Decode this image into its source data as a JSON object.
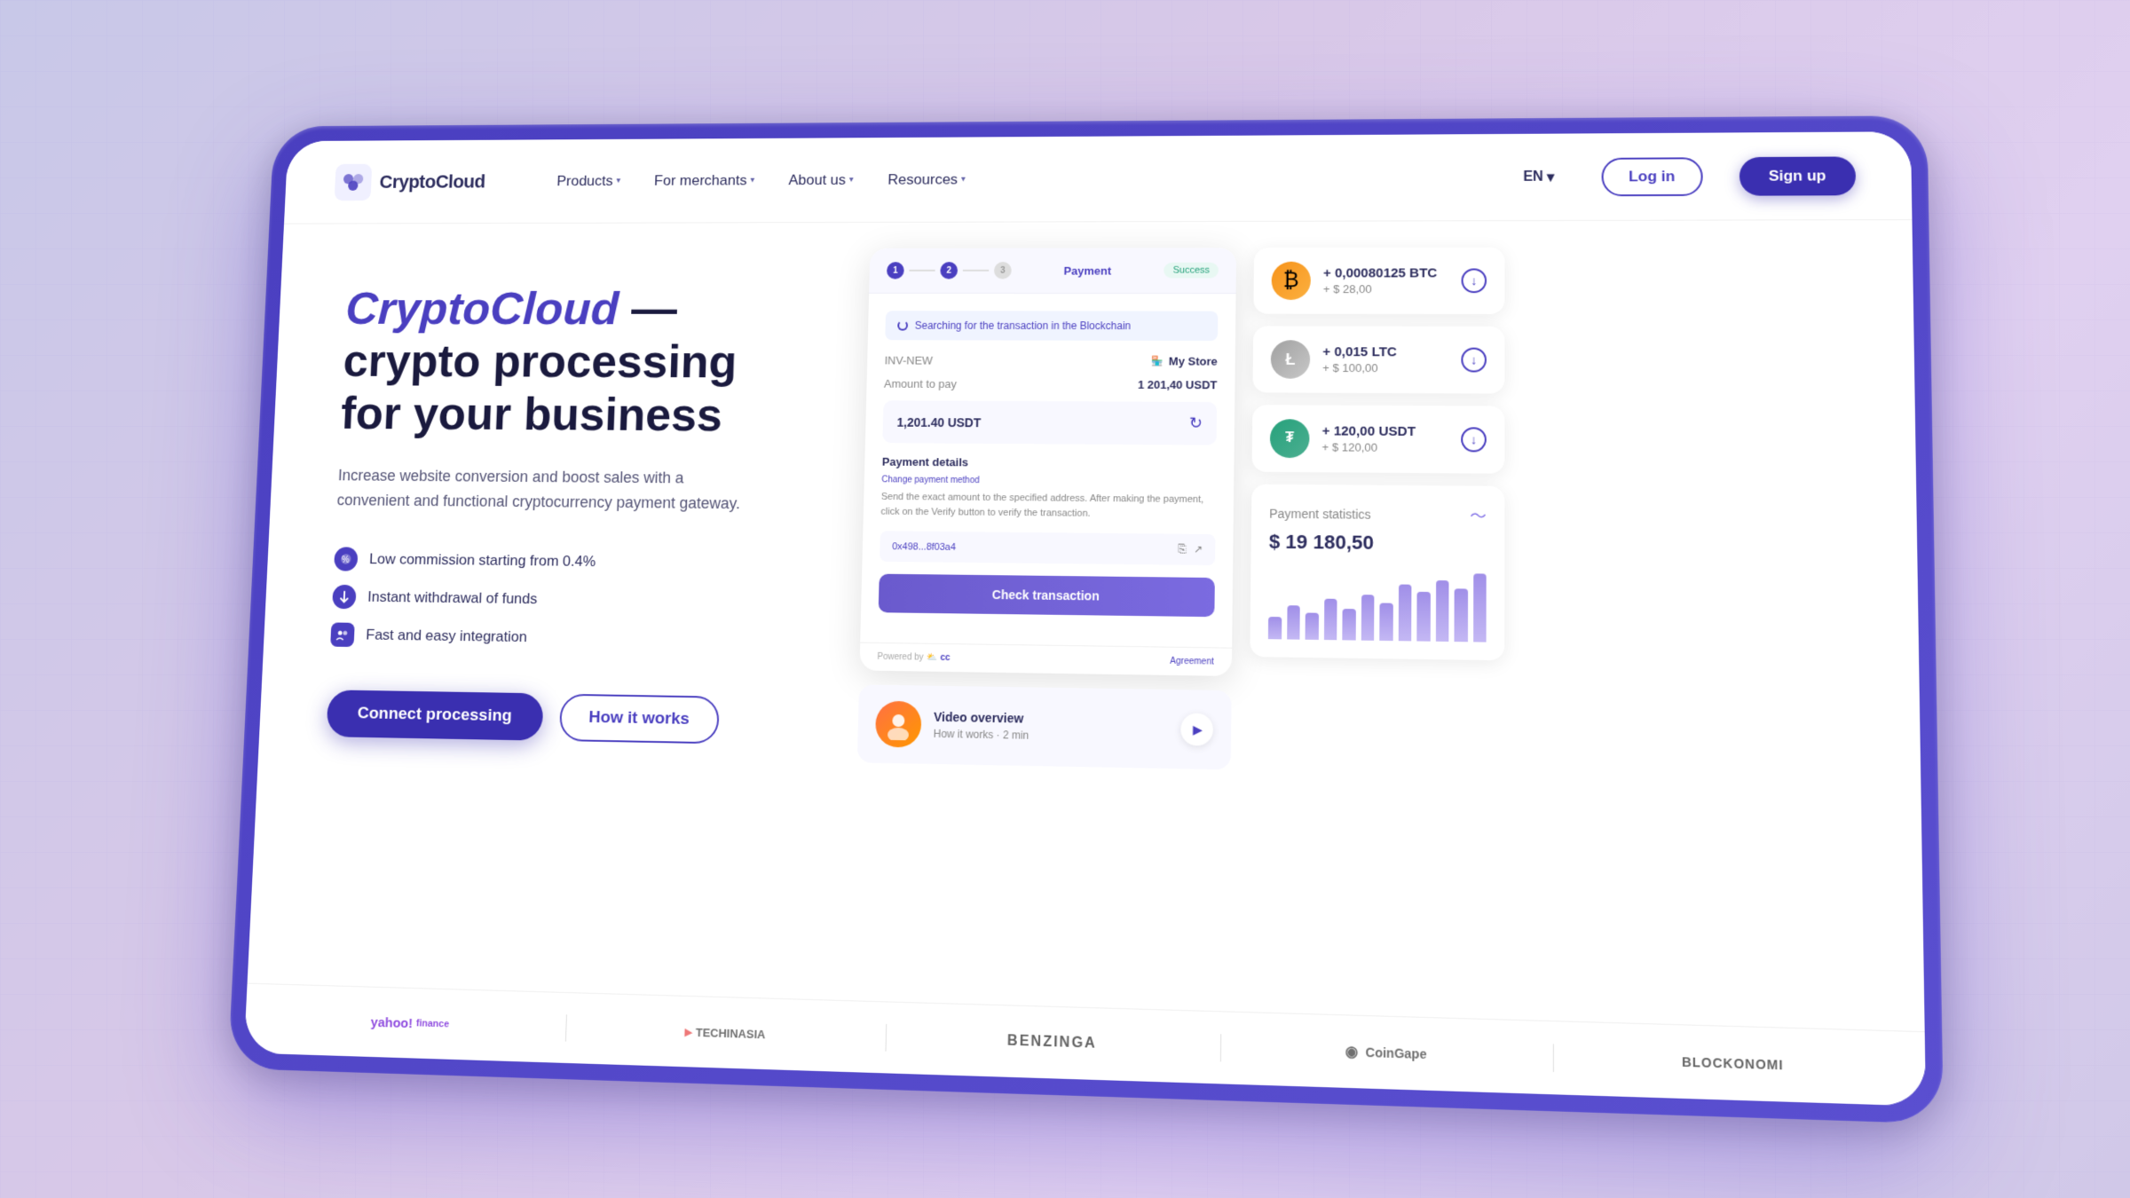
{
  "background": {
    "color_from": "#c8c8e8",
    "color_to": "#d0c8e8"
  },
  "navbar": {
    "logo_text": "CryptoCloud",
    "nav_items": [
      {
        "label": "Products",
        "has_dropdown": true
      },
      {
        "label": "For merchants",
        "has_dropdown": true
      },
      {
        "label": "About us",
        "has_dropdown": true
      },
      {
        "label": "Resources",
        "has_dropdown": true
      }
    ],
    "lang": "EN",
    "login_label": "Log in",
    "signup_label": "Sign up"
  },
  "hero": {
    "title_plain": " — crypto processing for your business",
    "title_highlight": "CryptoCloud",
    "subtitle": "Increase website conversion and boost sales with a convenient and functional cryptocurrency payment gateway.",
    "features": [
      {
        "text": "Low commission starting from 0.4%"
      },
      {
        "text": "Instant withdrawal of funds"
      },
      {
        "text": "Fast and easy integration"
      }
    ],
    "btn_connect": "Connect processing",
    "btn_howworks": "How it works"
  },
  "payment_widget": {
    "searching_text": "Searching for the transaction in the Blockchain",
    "store_label": "My Store",
    "invoice_label": "INV-NEW",
    "amount_label": "Amount to pay",
    "amount_value": "1 201,40 USDT",
    "payment_details_title": "Payment details",
    "payment_details_change": "Change payment method",
    "payment_details_text": "Send the exact amount to the specified address. After making the payment, click on the Verify button to verify the transaction.",
    "amount_field_value": "1,201.40 USDT",
    "address_value": "0x498...8f03a4",
    "check_transaction_btn": "Check transaction",
    "powered_by": "Powered by",
    "agreement_link": "Agreement"
  },
  "video": {
    "title": "Video overview",
    "subtitle": "How it works · 2 min"
  },
  "crypto_items": [
    {
      "coin": "BTC",
      "amount": "+ 0,00080125 BTC",
      "usd": "+ $ 28,00",
      "icon_type": "btc"
    },
    {
      "coin": "LTC",
      "amount": "+ 0,015 LTC",
      "usd": "+ $ 100,00",
      "icon_type": "ltc"
    },
    {
      "coin": "USDT",
      "amount": "+ 120,00 USDT",
      "usd": "+ $ 120,00",
      "icon_type": "usdt"
    }
  ],
  "stats": {
    "title": "Payment statistics",
    "amount": "$ 19 180,50",
    "chart_bars": [
      30,
      45,
      35,
      55,
      42,
      60,
      50,
      75,
      65,
      80,
      70,
      90
    ]
  },
  "brands": [
    {
      "name": "yahoo! finance",
      "class": "yahoo"
    },
    {
      "name": "TECHNASIA",
      "class": "technasia"
    },
    {
      "name": "BENZINGA",
      "class": "benzinga"
    },
    {
      "name": "CoinGape",
      "class": "coingape"
    },
    {
      "name": "BLOCKONOMI",
      "class": "blockonomi"
    }
  ]
}
